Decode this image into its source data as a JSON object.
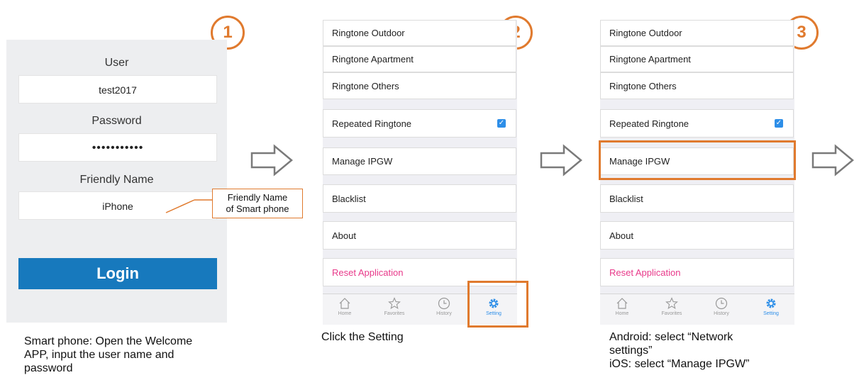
{
  "steps": [
    "1",
    "2",
    "3"
  ],
  "login": {
    "user_label": "User",
    "user_value": "test2017",
    "password_label": "Password",
    "password_value": "•••••••••••",
    "friendly_label": "Friendly Name",
    "friendly_value": "iPhone",
    "login_button": "Login"
  },
  "callout": {
    "line1": "Friendly Name",
    "line2": "of Smart phone"
  },
  "settings": {
    "items": [
      "Ringtone Outdoor",
      "Ringtone Apartment",
      "Ringtone Others",
      "Repeated Ringtone",
      "Manage IPGW",
      "Blacklist",
      "About",
      "Reset Application"
    ],
    "repeated_checked": true,
    "tabs": [
      "Home",
      "Favorites",
      "History",
      "Setting"
    ]
  },
  "captions": {
    "step1": [
      "Smart phone: Open the Welcome",
      "APP, input the user name and",
      "password"
    ],
    "step2": [
      "Click the Setting"
    ],
    "step3": [
      "Android: select “Network",
      "settings”",
      "iOS: select “Manage IPGW”"
    ]
  },
  "colors": {
    "accent_orange": "#e07a2e",
    "login_blue": "#1779bd",
    "tab_active_blue": "#2d8ee8",
    "reset_pink": "#e8398a",
    "panel_bg": "#edeef0"
  }
}
